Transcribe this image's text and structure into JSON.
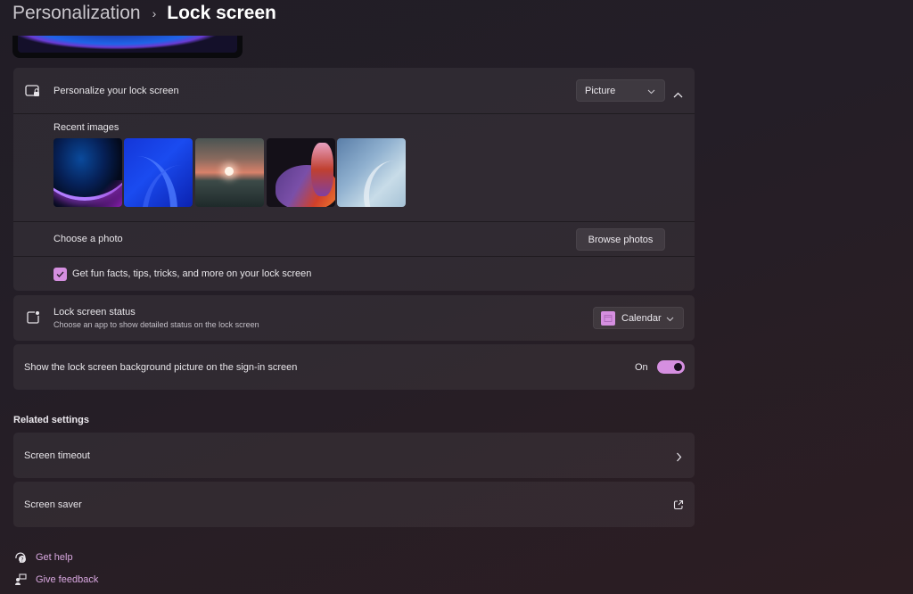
{
  "breadcrumb": {
    "parent": "Personalization",
    "separator": "›",
    "current": "Lock screen"
  },
  "personalize": {
    "icon": "lock-screen-icon",
    "label": "Personalize your lock screen",
    "dropdown_value": "Picture",
    "expanded": true,
    "recent_images_label": "Recent images",
    "recent_images": [
      {
        "name": "bloom-dark-blue-purple"
      },
      {
        "name": "blue-ribbon-waves"
      },
      {
        "name": "sunset-lake"
      },
      {
        "name": "colorful-flow-ribbon"
      },
      {
        "name": "light-blue-bloom"
      }
    ],
    "choose_photo_label": "Choose a photo",
    "browse_button": "Browse photos",
    "fun_facts_label": "Get fun facts, tips, tricks, and more on your lock screen",
    "fun_facts_checked": true
  },
  "status": {
    "icon": "status-app-icon",
    "label": "Lock screen status",
    "description": "Choose an app to show detailed status on the lock screen",
    "dropdown_value": "Calendar",
    "dropdown_icon": "calendar-icon"
  },
  "signin": {
    "label": "Show the lock screen background picture on the sign-in screen",
    "toggle_state": "On",
    "toggle_on": true
  },
  "related": {
    "title": "Related settings",
    "items": [
      {
        "label": "Screen timeout",
        "icon": "chevron-right-icon"
      },
      {
        "label": "Screen saver",
        "icon": "external-link-icon"
      }
    ]
  },
  "footer": {
    "help": "Get help",
    "feedback": "Give feedback"
  },
  "colors": {
    "accent": "#d58fe0",
    "link": "#d9a8e0"
  }
}
